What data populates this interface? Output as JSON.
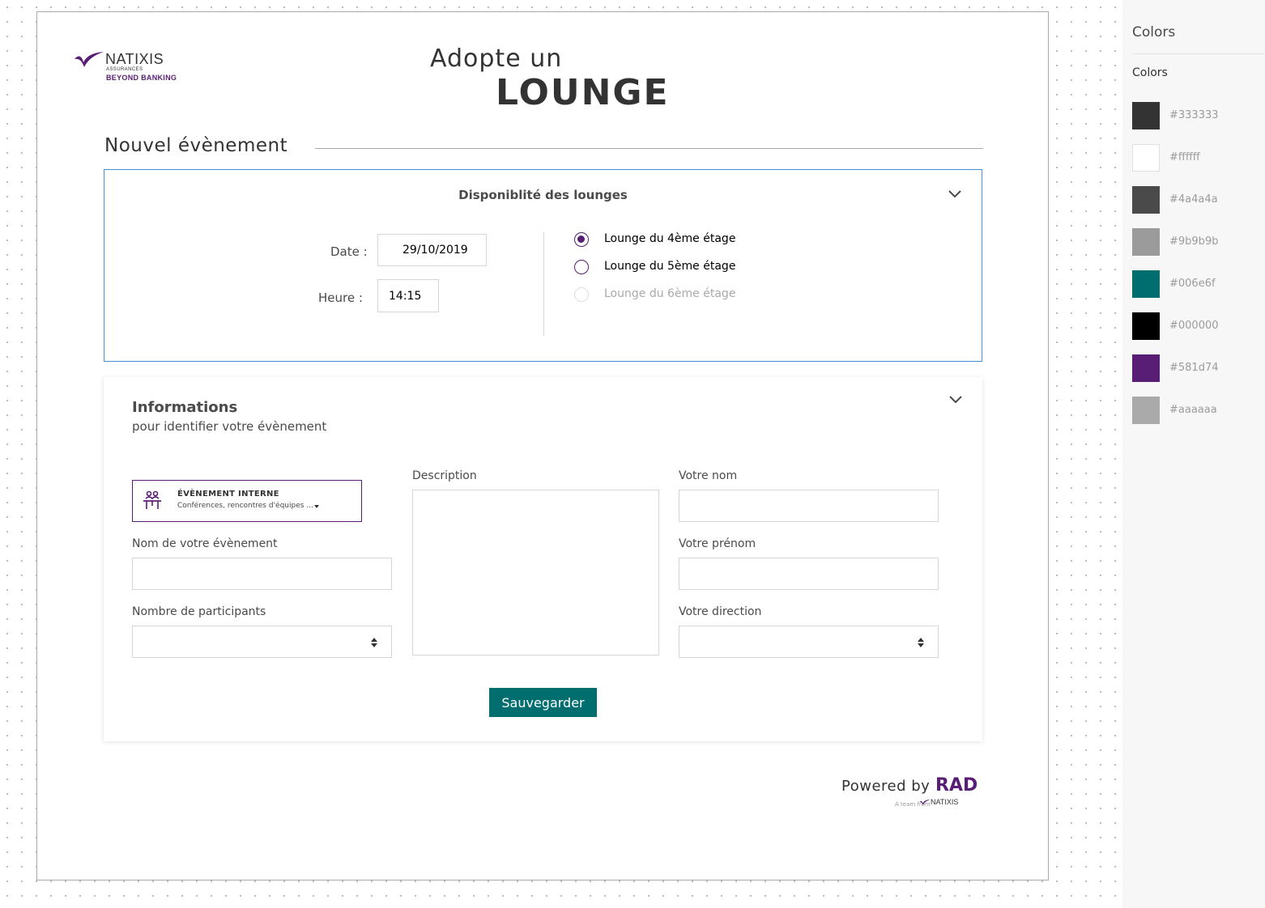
{
  "logo": {
    "brand": "NATIXIS",
    "sub": "ASSURANCES",
    "tagline": "BEYOND BANKING"
  },
  "header": {
    "title_line1": "Adopte un",
    "title_line2": "LOUNGE"
  },
  "section": {
    "title": "Nouvel évènement"
  },
  "availability": {
    "title": "Disponiblité des lounges",
    "date_label": "Date :",
    "date_value": "29/10/2019",
    "time_label": "Heure :",
    "time_value": "14:15",
    "lounges": [
      {
        "label": "Lounge du 4ème étage",
        "state": "selected"
      },
      {
        "label": "Lounge du 5ème étage",
        "state": "available"
      },
      {
        "label": "Lounge du 6ème étage",
        "state": "disabled"
      }
    ]
  },
  "info": {
    "title": "Informations",
    "subtitle": "pour identifier votre évènement",
    "event_type": {
      "title": "ÉVÈNEMENT INTERNE",
      "subtitle": "Conférences, rencontres d'équipes ...",
      "icon": "meeting-table-icon"
    },
    "event_name_label": "Nom de votre évènement",
    "event_name_value": "",
    "participants_label": "Nombre de participants",
    "participants_value": "",
    "description_label": "Description",
    "description_value": "",
    "last_name_label": "Votre nom",
    "last_name_value": "",
    "first_name_label": "Votre prénom",
    "first_name_value": "",
    "direction_label": "Votre direction",
    "direction_value": "",
    "save_label": "Sauvegarder"
  },
  "footer": {
    "powered_by": "Powered by",
    "brand": "RAD",
    "team_from": "A team from",
    "team_brand": "NATIXIS"
  },
  "colors_panel": {
    "title": "Colors",
    "subtitle": "Colors",
    "swatches": [
      {
        "hex": "#333333"
      },
      {
        "hex": "#ffffff"
      },
      {
        "hex": "#4a4a4a"
      },
      {
        "hex": "#9b9b9b"
      },
      {
        "hex": "#006e6f"
      },
      {
        "hex": "#000000"
      },
      {
        "hex": "#581d74"
      },
      {
        "hex": "#aaaaaa"
      }
    ]
  },
  "theme": {
    "accent": "#581d74",
    "primary": "#006e6f",
    "text": "#333333",
    "focus_border": "#4a90d9"
  }
}
